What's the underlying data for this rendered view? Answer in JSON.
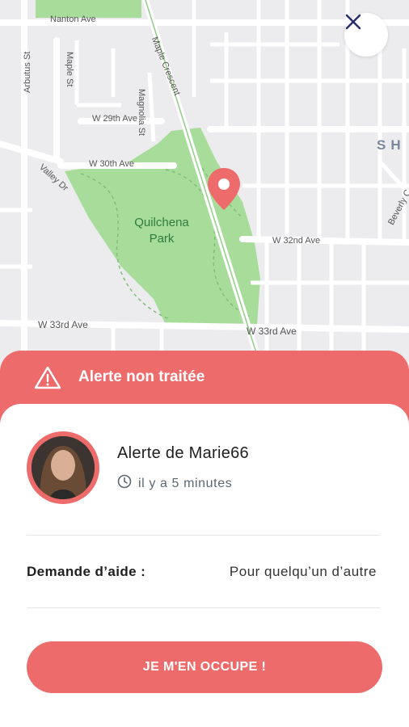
{
  "map": {
    "streets": {
      "nanton": "Nanton Ave",
      "arbutus": "Arbutus St",
      "maple_crescent": "Maple Crescent",
      "maple_st": "Maple St",
      "magnolia": "Magnolia St",
      "w29": "W 29th Ave",
      "w30": "W 30th Ave",
      "valley": "Valley Dr",
      "w32": "W 32nd Ave",
      "w33_left": "W 33rd Ave",
      "w33_right": "W 33rd Ave",
      "beverly": "Beverly C"
    },
    "park_name_line1": "Quilchena",
    "park_name_line2": "Park",
    "district": "SH"
  },
  "alert": {
    "header_title": "Alerte non traitée",
    "title": "Alerte de Marie66",
    "time_ago": "il y a 5 minutes",
    "help_label": "Demande d’aide :",
    "help_value": "Pour quelqu’un d’autre",
    "cta_label": "JE M'EN OCCUPE !"
  },
  "colors": {
    "accent": "#ee6b6b",
    "park": "#a8dc9a"
  },
  "icons": {
    "close": "close-icon",
    "pin": "map-pin-icon",
    "warning": "warning-icon",
    "clock": "clock-icon"
  }
}
